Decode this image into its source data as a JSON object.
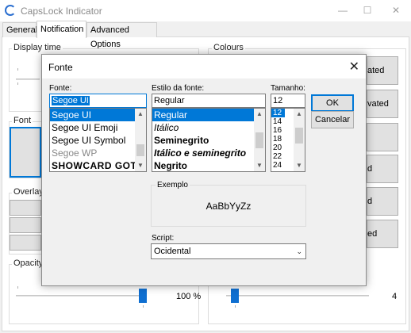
{
  "window": {
    "title": "CapsLock Indicator",
    "minimize_glyph": "—",
    "maximize_glyph": "☐",
    "close_glyph": "✕"
  },
  "tabs": [
    {
      "label": "General"
    },
    {
      "label": "Notification"
    },
    {
      "label": "Advanced Options"
    }
  ],
  "groups": {
    "display_time": "Display time",
    "font": "Font",
    "overlay": "Overlay",
    "opacity": "Opacity",
    "colours": "Colours"
  },
  "colour_buttons": [
    "ated",
    "vated",
    "",
    "d",
    "d",
    "ed"
  ],
  "opacity": {
    "value_text": "100 %",
    "level_percent": 100
  },
  "right_slider": {
    "value_text": "4"
  },
  "dialog": {
    "title": "Fonte",
    "close_glyph": "✕",
    "font_label": "Fonte:",
    "font_value": "Segoe UI",
    "font_items": [
      "Segoe UI",
      "Segoe UI Emoji",
      "Segoe UI Symbol",
      "Segoe WP",
      "SHOWCARD GOTHI"
    ],
    "style_label": "Estilo da fonte:",
    "style_value": "Regular",
    "style_items": [
      "Regular",
      "Itálico",
      "Seminegrito",
      "Itálico e seminegrito",
      "Negrito"
    ],
    "size_label": "Tamanho:",
    "size_value": "12",
    "size_items": [
      "12",
      "14",
      "16",
      "18",
      "20",
      "22",
      "24"
    ],
    "ok": "OK",
    "cancel": "Cancelar",
    "sample_label": "Exemplo",
    "sample_text": "AaBbYyZz",
    "script_label": "Script:",
    "script_value": "Ocidental"
  }
}
